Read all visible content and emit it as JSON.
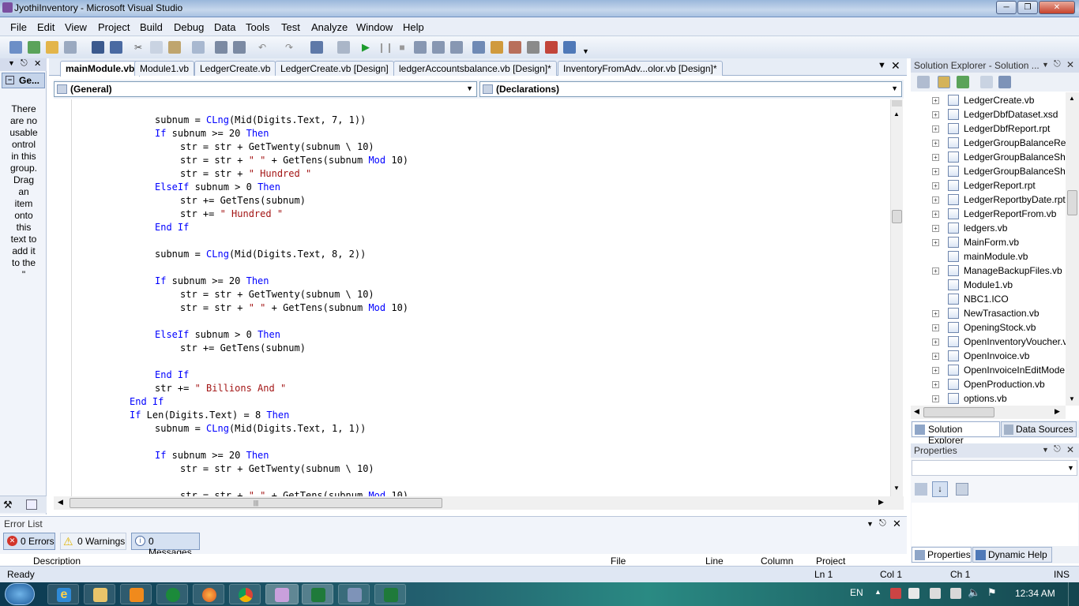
{
  "window": {
    "title": "JyothiInventory - Microsoft Visual Studio"
  },
  "menu": [
    "File",
    "Edit",
    "View",
    "Project",
    "Build",
    "Debug",
    "Data",
    "Tools",
    "Test",
    "Analyze",
    "Window",
    "Help"
  ],
  "toolbox": {
    "title": "Ge...",
    "message": [
      "There",
      "are no",
      "usable",
      "ontrol",
      "in this",
      "group.",
      "Drag",
      "an",
      "item",
      "onto",
      "this",
      "text to",
      "add it",
      "to the",
      "\""
    ]
  },
  "tabs": [
    "mainModule.vb",
    "Module1.vb",
    "LedgerCreate.vb",
    "LedgerCreate.vb [Design]",
    "ledgerAccountsbalance.vb [Design]*",
    "InventoryFromAdv...olor.vb [Design]*"
  ],
  "editor": {
    "left_dropdown": "(General)",
    "right_dropdown": "(Declarations)"
  },
  "code_lines": [
    {
      "indent": 3,
      "tokens": [
        [
          "subnum = ",
          ""
        ],
        [
          "CLng",
          "k"
        ],
        [
          "(Mid(Digits.Text, 7, 1))",
          ""
        ]
      ]
    },
    {
      "indent": 3,
      "tokens": [
        [
          "If",
          "k"
        ],
        [
          " subnum >= 20 ",
          ""
        ],
        [
          "Then",
          "k"
        ]
      ]
    },
    {
      "indent": 4,
      "tokens": [
        [
          "str = str + GetTwenty(subnum \\ 10)",
          ""
        ]
      ]
    },
    {
      "indent": 4,
      "tokens": [
        [
          "str = str + ",
          ""
        ],
        [
          "\" \"",
          "s"
        ],
        [
          " + GetTens(subnum ",
          ""
        ],
        [
          "Mod",
          "k"
        ],
        [
          " 10)",
          ""
        ]
      ]
    },
    {
      "indent": 4,
      "tokens": [
        [
          "str = str + ",
          ""
        ],
        [
          "\" Hundred \"",
          "s"
        ]
      ]
    },
    {
      "indent": 3,
      "tokens": [
        [
          "ElseIf",
          "k"
        ],
        [
          " subnum > 0 ",
          ""
        ],
        [
          "Then",
          "k"
        ]
      ]
    },
    {
      "indent": 4,
      "tokens": [
        [
          "str += GetTens(subnum)",
          ""
        ]
      ]
    },
    {
      "indent": 4,
      "tokens": [
        [
          "str += ",
          ""
        ],
        [
          "\" Hundred \"",
          "s"
        ]
      ]
    },
    {
      "indent": 3,
      "tokens": [
        [
          "End If",
          "k"
        ]
      ]
    },
    {
      "indent": 0,
      "tokens": []
    },
    {
      "indent": 3,
      "tokens": [
        [
          "subnum = ",
          ""
        ],
        [
          "CLng",
          "k"
        ],
        [
          "(Mid(Digits.Text, 8, 2))",
          ""
        ]
      ]
    },
    {
      "indent": 0,
      "tokens": []
    },
    {
      "indent": 3,
      "tokens": [
        [
          "If",
          "k"
        ],
        [
          " subnum >= 20 ",
          ""
        ],
        [
          "Then",
          "k"
        ]
      ]
    },
    {
      "indent": 4,
      "tokens": [
        [
          "str = str + GetTwenty(subnum \\ 10)",
          ""
        ]
      ]
    },
    {
      "indent": 4,
      "tokens": [
        [
          "str = str + ",
          ""
        ],
        [
          "\" \"",
          "s"
        ],
        [
          " + GetTens(subnum ",
          ""
        ],
        [
          "Mod",
          "k"
        ],
        [
          " 10)",
          ""
        ]
      ]
    },
    {
      "indent": 0,
      "tokens": []
    },
    {
      "indent": 3,
      "tokens": [
        [
          "ElseIf",
          "k"
        ],
        [
          " subnum > 0 ",
          ""
        ],
        [
          "Then",
          "k"
        ]
      ]
    },
    {
      "indent": 4,
      "tokens": [
        [
          "str += GetTens(subnum)",
          ""
        ]
      ]
    },
    {
      "indent": 0,
      "tokens": []
    },
    {
      "indent": 3,
      "tokens": [
        [
          "End If",
          "k"
        ]
      ]
    },
    {
      "indent": 3,
      "tokens": [
        [
          "str += ",
          ""
        ],
        [
          "\" Billions And \"",
          "s"
        ]
      ]
    },
    {
      "indent": 2,
      "tokens": [
        [
          "End If",
          "k"
        ]
      ]
    },
    {
      "indent": 2,
      "tokens": [
        [
          "If",
          "k"
        ],
        [
          " Len(Digits.Text) = 8 ",
          ""
        ],
        [
          "Then",
          "k"
        ]
      ]
    },
    {
      "indent": 3,
      "tokens": [
        [
          "subnum = ",
          ""
        ],
        [
          "CLng",
          "k"
        ],
        [
          "(Mid(Digits.Text, 1, 1))",
          ""
        ]
      ]
    },
    {
      "indent": 0,
      "tokens": []
    },
    {
      "indent": 3,
      "tokens": [
        [
          "If",
          "k"
        ],
        [
          " subnum >= 20 ",
          ""
        ],
        [
          "Then",
          "k"
        ]
      ]
    },
    {
      "indent": 4,
      "tokens": [
        [
          "str = str + GetTwenty(subnum \\ 10)",
          ""
        ]
      ]
    },
    {
      "indent": 0,
      "tokens": []
    },
    {
      "indent": 4,
      "tokens": [
        [
          "str = str + ",
          ""
        ],
        [
          "\" \"",
          "s"
        ],
        [
          " + GetTens(subnum ",
          ""
        ],
        [
          "Mod",
          "k"
        ],
        [
          " 10)",
          ""
        ]
      ]
    }
  ],
  "solution_explorer": {
    "title": "Solution Explorer - Solution ...",
    "items": [
      {
        "label": "LedgerCreate.vb",
        "expand": true
      },
      {
        "label": "LedgerDbfDataset.xsd",
        "expand": true
      },
      {
        "label": "LedgerDbfReport.rpt",
        "expand": true
      },
      {
        "label": "LedgerGroupBalanceRep",
        "expand": true
      },
      {
        "label": "LedgerGroupBalanceShe",
        "expand": true
      },
      {
        "label": "LedgerGroupBalanceShe",
        "expand": true
      },
      {
        "label": "LedgerReport.rpt",
        "expand": true
      },
      {
        "label": "LedgerReportbyDate.rpt",
        "expand": true
      },
      {
        "label": "LedgerReportFrom.vb",
        "expand": true
      },
      {
        "label": "ledgers.vb",
        "expand": true
      },
      {
        "label": "MainForm.vb",
        "expand": true
      },
      {
        "label": "mainModule.vb",
        "expand": false
      },
      {
        "label": "ManageBackupFiles.vb",
        "expand": true
      },
      {
        "label": "Module1.vb",
        "expand": false
      },
      {
        "label": "NBC1.ICO",
        "expand": false
      },
      {
        "label": "NewTrasaction.vb",
        "expand": true
      },
      {
        "label": "OpeningStock.vb",
        "expand": true
      },
      {
        "label": "OpenInventoryVoucher.v",
        "expand": true
      },
      {
        "label": "OpenInvoice.vb",
        "expand": true
      },
      {
        "label": "OpenInvoiceInEditMode",
        "expand": true
      },
      {
        "label": "OpenProduction.vb",
        "expand": true
      },
      {
        "label": "options.vb",
        "expand": true
      }
    ],
    "tab1": "Solution Explorer",
    "tab2": "Data Sources"
  },
  "properties": {
    "title": "Properties",
    "tab1": "Properties",
    "tab2": "Dynamic Help"
  },
  "error_list": {
    "title": "Error List",
    "errors": "0 Errors",
    "warnings": "0 Warnings",
    "messages": "0 Messages",
    "columns": [
      "Description",
      "File",
      "Line",
      "Column",
      "Project"
    ]
  },
  "status": {
    "text": "Ready",
    "ln": "Ln 1",
    "col": "Col 1",
    "ch": "Ch 1",
    "mode": "INS"
  },
  "taskbar": {
    "lang": "EN",
    "time": "12:34 AM"
  }
}
